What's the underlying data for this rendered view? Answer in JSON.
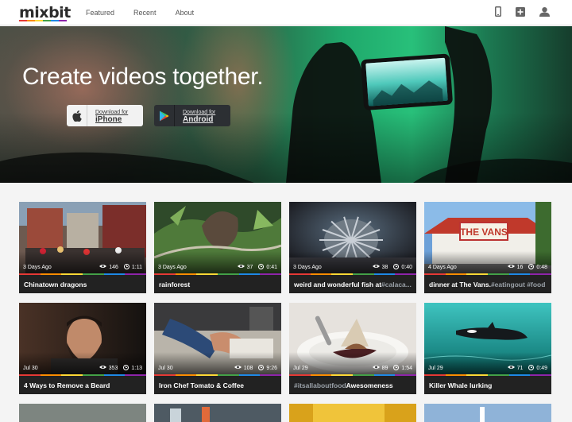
{
  "header": {
    "logo_a": "mix",
    "logo_b": "bit",
    "nav": [
      "Featured",
      "Recent",
      "About"
    ],
    "icons": [
      "phone-icon",
      "add-icon",
      "user-icon"
    ]
  },
  "hero": {
    "title": "Create videos together.",
    "iphone_small": "Download for",
    "iphone_big": "iPhone",
    "android_small": "Download for",
    "android_big": "Android"
  },
  "stripe_colors": [
    "#e53935",
    "#fb8c00",
    "#fdd835",
    "#43a047",
    "#1e88e5",
    "#8e24aa"
  ],
  "videos": [
    {
      "date": "3 Days Ago",
      "views": "146",
      "duration": "1:11",
      "title": "Chinatown dragons",
      "tag": "",
      "thumb": "chinatown"
    },
    {
      "date": "3 Days Ago",
      "views": "37",
      "duration": "0:41",
      "title": "rainforest",
      "tag": "",
      "thumb": "rainforest"
    },
    {
      "date": "3 Days Ago",
      "views": "38",
      "duration": "0:40",
      "title": "weird and wonderful fish at ",
      "tag": "#calaca...",
      "thumb": "fish"
    },
    {
      "date": "4 Days Ago",
      "views": "16",
      "duration": "0:48",
      "title": "dinner at The Vans. ",
      "tag": "#eatingout #food",
      "thumb": "vans"
    },
    {
      "date": "Jul 30",
      "views": "353",
      "duration": "1:13",
      "title": "4 Ways to Remove a Beard",
      "tag": "",
      "thumb": "beard"
    },
    {
      "date": "Jul 30",
      "views": "108",
      "duration": "9:26",
      "title": "Iron Chef Tomato & Coffee",
      "tag": "",
      "thumb": "chef"
    },
    {
      "date": "Jul 29",
      "views": "89",
      "duration": "1:54",
      "title": "Awesomeness",
      "tag": "#itsallaboutfood ",
      "tag_first": true,
      "thumb": "dessert"
    },
    {
      "date": "Jul 29",
      "views": "71",
      "duration": "0:49",
      "title": "Killer Whale lurking",
      "tag": "",
      "thumb": "whale"
    }
  ]
}
